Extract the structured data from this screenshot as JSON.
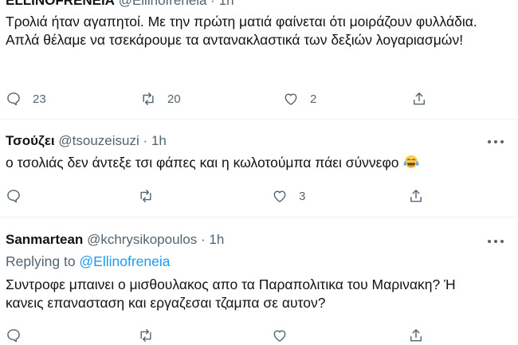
{
  "tweets": [
    {
      "display_name": "ELLINOFRENEIA",
      "handle": "@Ellinofreneia",
      "dot": "·",
      "time": "1h",
      "text": "Τρολιά ήταν αγαπητοί. Με την πρώτη ματιά φαίνεται ότι μοιράζουν φυλλάδια. Απλά θέλαμε να τσεκάρουμε τα αντανακλαστικά των δεξιών λογαριασμών!",
      "replies": "23",
      "retweets": "20",
      "likes": "2"
    },
    {
      "display_name": "Τσούζει",
      "handle": "@tsouzeisuzi",
      "dot": "·",
      "time": "1h",
      "text": "ο τσολιάς δεν άντεξε τσι φάπες και η κωλοτούμπα πάει σύννεφο",
      "emoji": "face-with-tears-of-joy",
      "replies": "",
      "retweets": "",
      "likes": "3"
    },
    {
      "display_name": "Sanmartean",
      "handle": "@kchrysikopoulos",
      "dot": "·",
      "time": "1h",
      "replying_prefix": "Replying to ",
      "replying_to": "@Ellinofreneia",
      "text": "Συντροφε μπαινει ο μισθουλακος απο τα Παραπολιτικα του Μαρινακη? Ή κανεις επανασταση και εργαζεσαι τζαμπα σε αυτον?"
    }
  ],
  "colors": {
    "text": "#0f1419",
    "secondary": "#536471",
    "link": "#1d9bf0",
    "divider": "#eff3f4"
  }
}
